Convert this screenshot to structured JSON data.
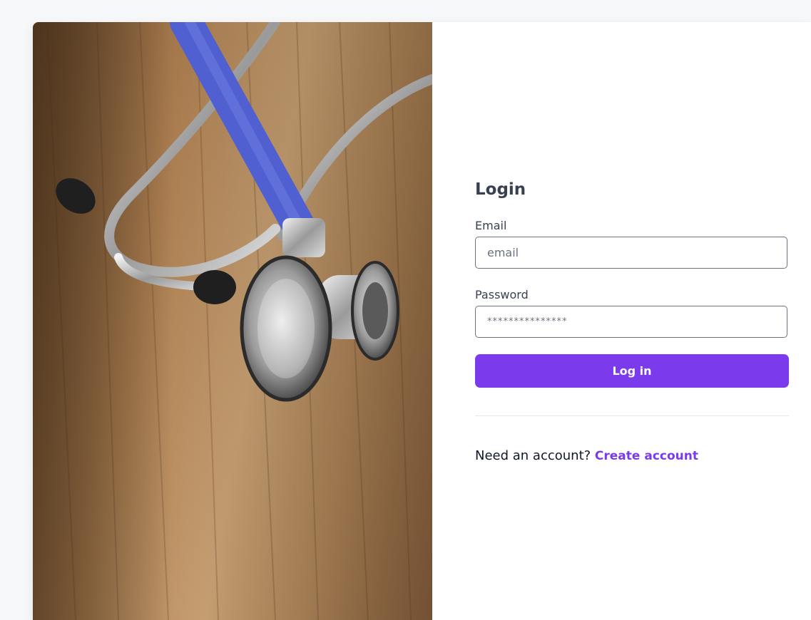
{
  "login": {
    "title": "Login",
    "email_label": "Email",
    "email_placeholder": "email",
    "email_value": "",
    "password_label": "Password",
    "password_placeholder": "***************",
    "password_value": "",
    "submit_label": "Log in",
    "signup_prompt": "Need an account?",
    "signup_link": "Create account"
  },
  "colors": {
    "accent": "#7c3aed",
    "page_bg": "#f7f8fa",
    "text": "#374151"
  },
  "image": {
    "subject": "stethoscope-on-wood-icon"
  }
}
